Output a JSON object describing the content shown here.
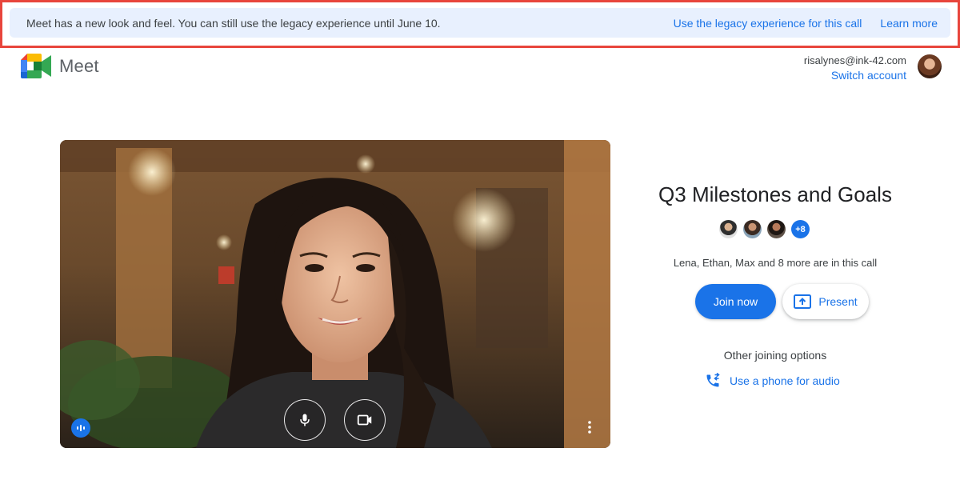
{
  "banner": {
    "message": "Meet has a new look and feel. You can still use the legacy experience until June 10.",
    "legacy_link": "Use the legacy experience for this call",
    "learn_more": "Learn more"
  },
  "app": {
    "name": "Meet"
  },
  "account": {
    "email": "risalynes@ink-42.com",
    "switch_label": "Switch account"
  },
  "meeting": {
    "title": "Q3 Milestones and Goals",
    "extra_participants": "+8",
    "in_call_text": "Lena, Ethan, Max and 8 more are in this call",
    "join_label": "Join now",
    "present_label": "Present",
    "other_options_label": "Other joining options",
    "phone_audio_label": "Use a phone for audio"
  },
  "colors": {
    "accent": "#1a73e8",
    "banner_bg": "#e8f0fe",
    "banner_border": "#e8453c"
  },
  "icons": [
    "meet-logo-icon",
    "mic-icon",
    "camera-icon",
    "audio-level-icon",
    "more-vert-icon",
    "present-icon",
    "phone-audio-icon"
  ]
}
